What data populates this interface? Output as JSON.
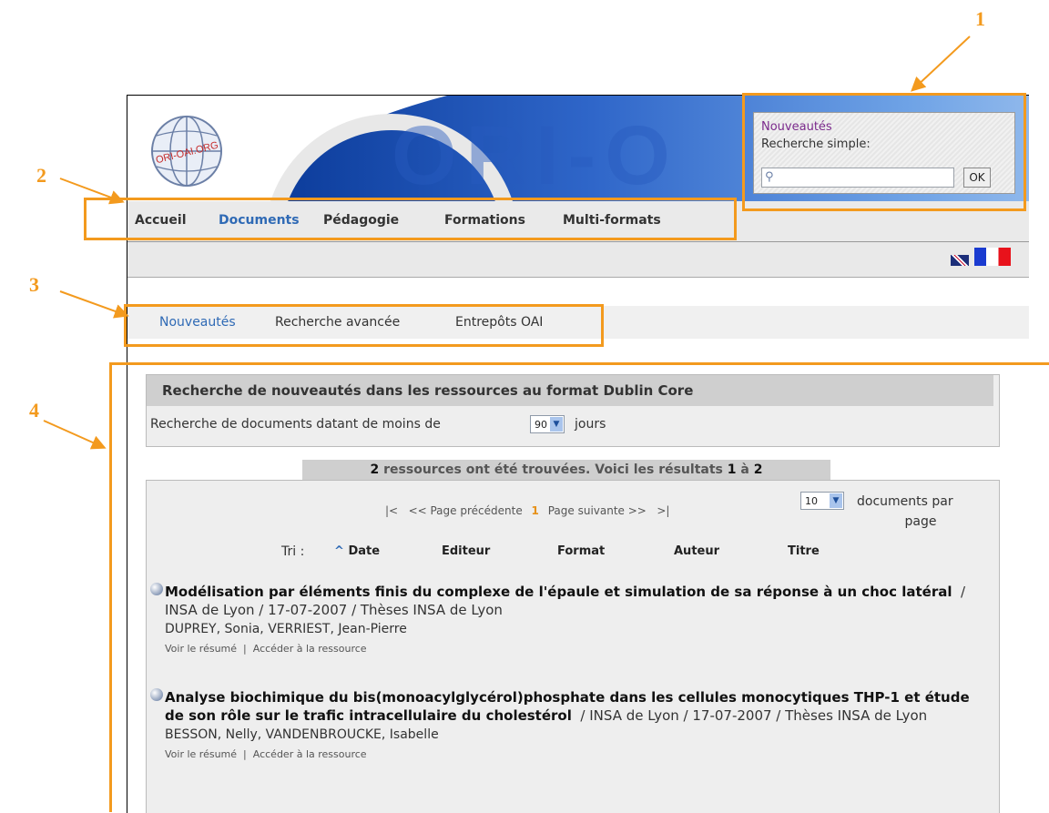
{
  "callouts": {
    "n1": "1",
    "n2": "2",
    "n3": "3",
    "n4": "4"
  },
  "logo": {
    "text": "ORI-OAI.ORG"
  },
  "banner": {
    "word": "ORI-O"
  },
  "search": {
    "link": "Nouveautés",
    "label": "Recherche simple:",
    "button": "OK",
    "value": ""
  },
  "nav": {
    "items": [
      "Accueil",
      "Documents",
      "Pédagogie",
      "Formations",
      "Multi-formats"
    ]
  },
  "lang": {
    "en": "English",
    "fr": "Français"
  },
  "subnav": {
    "items": [
      "Nouveautés",
      "Recherche avancée",
      "Entrepôts OAI"
    ]
  },
  "panel": {
    "title": "Recherche de nouveautés dans les ressources au format Dublin Core",
    "text": "Recherche de documents datant de moins de",
    "days_value": "90",
    "days_label": "jours"
  },
  "results": {
    "count": "2",
    "mid": "ressources ont été trouvées. Voici les résultats",
    "from": "1",
    "to_word": "à",
    "to": "2"
  },
  "pager": {
    "first": "|<",
    "prev": "<< Page précédente",
    "current": "1",
    "next": "Page suivante >>",
    "last": ">|",
    "per_page_value": "10",
    "per_page_l1": "documents par",
    "per_page_l2": "page"
  },
  "sort": {
    "label": "Tri :",
    "keys": [
      "Date",
      "Editeur",
      "Format",
      "Auteur",
      "Titre"
    ],
    "caret": "^"
  },
  "records": [
    {
      "title": "Modélisation par éléments finis du complexe de l'épaule et simulation de sa réponse à un choc latéral",
      "meta": "/ INSA de Lyon / 17-07-2007 / Thèses INSA de Lyon",
      "authors": "DUPREY, Sonia, VERRIEST, Jean-Pierre",
      "summary": "Voir le résumé",
      "sep": "|",
      "access": "Accéder à la ressource"
    },
    {
      "title": "Analyse biochimique du bis(monoacylglycérol)phosphate dans les cellules monocytiques THP-1 et étude de son rôle sur le trafic intracellulaire du cholestérol",
      "meta": "/ INSA de Lyon / 17-07-2007 / Thèses INSA de Lyon",
      "authors": "BESSON, Nelly, VANDENBROUCKE, Isabelle",
      "summary": "Voir le résumé",
      "sep": "|",
      "access": "Accéder à la ressource"
    }
  ],
  "colors": {
    "accent": "#f39a1e",
    "link": "#2f6ab5",
    "active_page": "#e69119",
    "visited": "#7b2a8c"
  }
}
